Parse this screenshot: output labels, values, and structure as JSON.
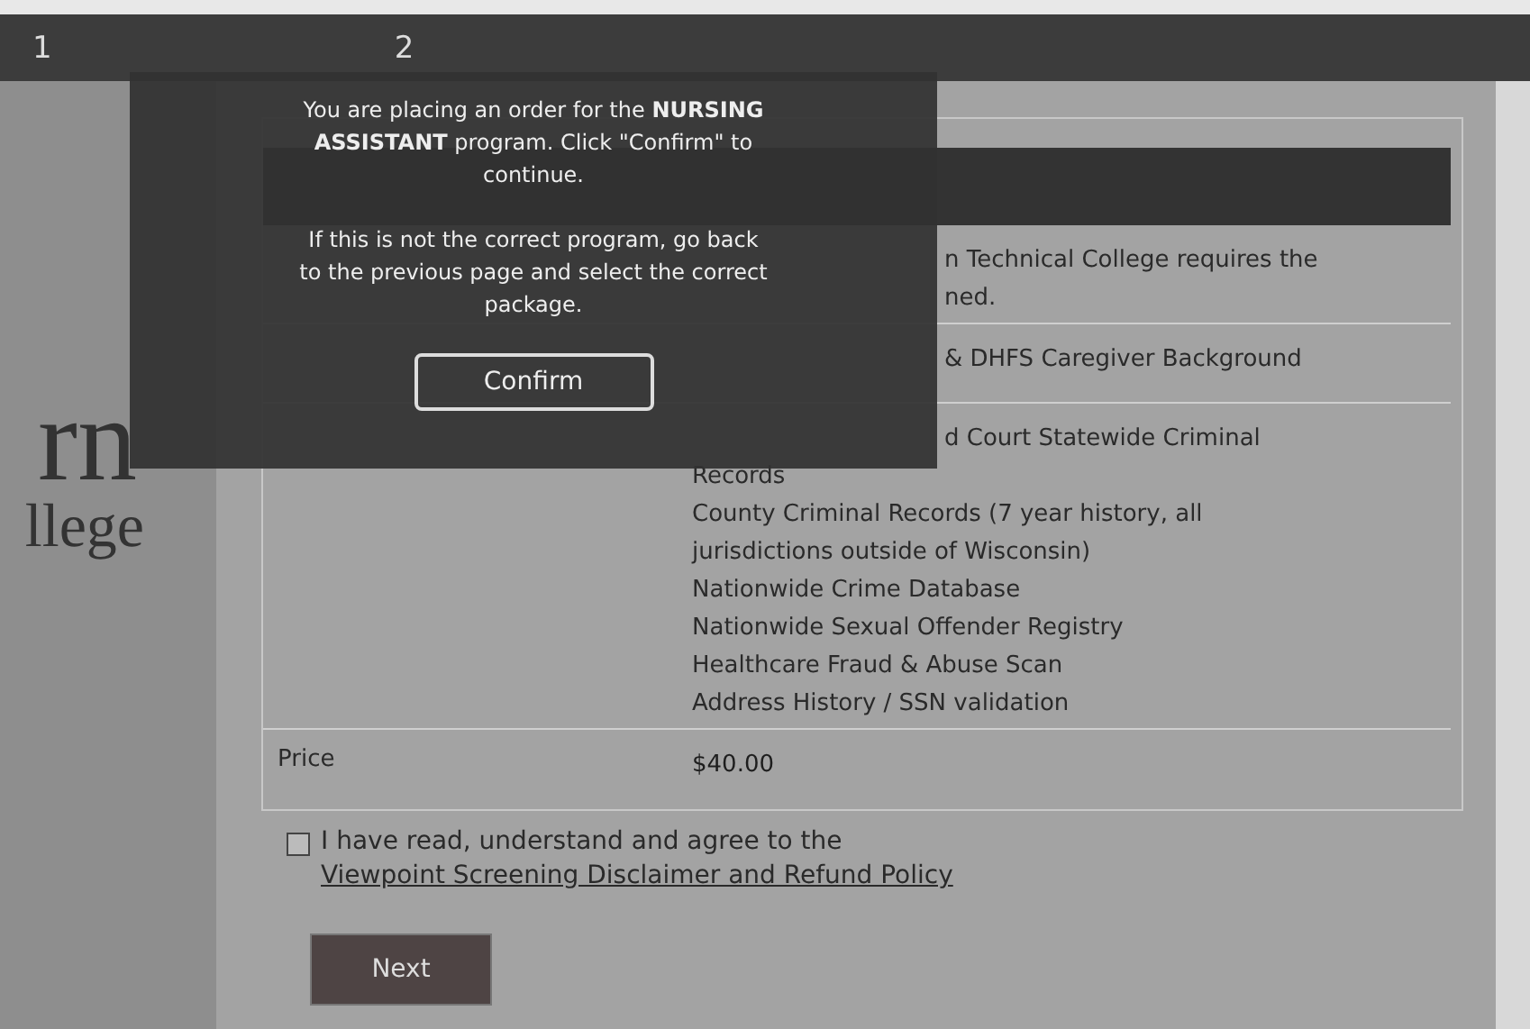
{
  "steps": [
    {
      "label": "1"
    },
    {
      "label": "2"
    }
  ],
  "logo": {
    "line_1": "rn",
    "line_2": "llege"
  },
  "package_rows": [
    {
      "lines": [
        {
          "text": "n Technical College requires the",
          "kind": "covered"
        },
        {
          "text": "ned.",
          "kind": "covered"
        }
      ]
    },
    {
      "lines": [
        {
          "text": "& DHFS Caregiver Background",
          "kind": "covered"
        }
      ]
    },
    {
      "lines": [
        {
          "text": "d Court Statewide Criminal",
          "kind": "covered"
        },
        {
          "text": "Records",
          "kind": "full"
        },
        {
          "text": "County Criminal Records (7 year history, all",
          "kind": "full"
        },
        {
          "text": "jurisdictions outside of Wisconsin)",
          "kind": "full"
        },
        {
          "text": "Nationwide Crime Database",
          "kind": "full"
        },
        {
          "text": "Nationwide Sexual Offender Registry",
          "kind": "full"
        },
        {
          "text": "Healthcare Fraud & Abuse Scan",
          "kind": "full"
        },
        {
          "text": "Address History / SSN validation",
          "kind": "full"
        }
      ]
    }
  ],
  "price": {
    "label": "Price",
    "value": "$40.00"
  },
  "agreement": {
    "checked": false,
    "text": "I have read, understand and agree to the",
    "link": "Viewpoint Screening Disclaimer and Refund Policy"
  },
  "next_button": "Next",
  "modal": {
    "message": "You are placing an order for the **NURSING ASSISTANT** program. Click \"Confirm\" to continue.",
    "hint": "If this is not the correct program, go back to the previous page and select the correct package.",
    "button": "Confirm"
  }
}
